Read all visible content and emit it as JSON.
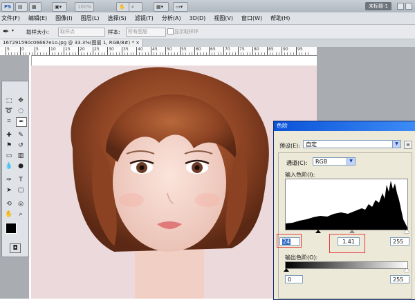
{
  "appbar": {
    "logo": "PS",
    "zoom": "100%",
    "doc_badge": "未标题-1"
  },
  "menu": [
    "文件(F)",
    "编辑(E)",
    "图像(I)",
    "图层(L)",
    "选择(S)",
    "滤镜(T)",
    "分析(A)",
    "3D(D)",
    "视图(V)",
    "窗口(W)",
    "帮助(H)"
  ],
  "options": {
    "sample_size_label": "取样大小:",
    "sample_size_value": "取样点",
    "sample_label": "样本:",
    "sample_value": "所有图层",
    "show_ring_label": "显示取样环"
  },
  "document_tab": "167291590c06667e1o.jpg @ 33.3%(图层 1, RGB/8#) * ×",
  "ruler_ticks": [
    "5",
    "0",
    "5",
    "10",
    "15",
    "20",
    "25",
    "30",
    "35",
    "40",
    "45",
    "50",
    "55",
    "60",
    "65",
    "70",
    "75",
    "80",
    "85",
    "90",
    "95"
  ],
  "levels": {
    "title": "色阶",
    "preset_label": "预设(E):",
    "preset_value": "自定",
    "channel_label": "通道(C):",
    "channel_value": "RGB",
    "input_levels_label": "输入色阶(I):",
    "input_black": "24",
    "input_gamma": "1.41",
    "input_white": "255",
    "output_levels_label": "输出色阶(O):",
    "output_black": "0",
    "output_white": "255"
  },
  "colors": {
    "dialog_title": "#0a52d8",
    "highlight": "#e23a3a",
    "selection": "#316ac5"
  }
}
